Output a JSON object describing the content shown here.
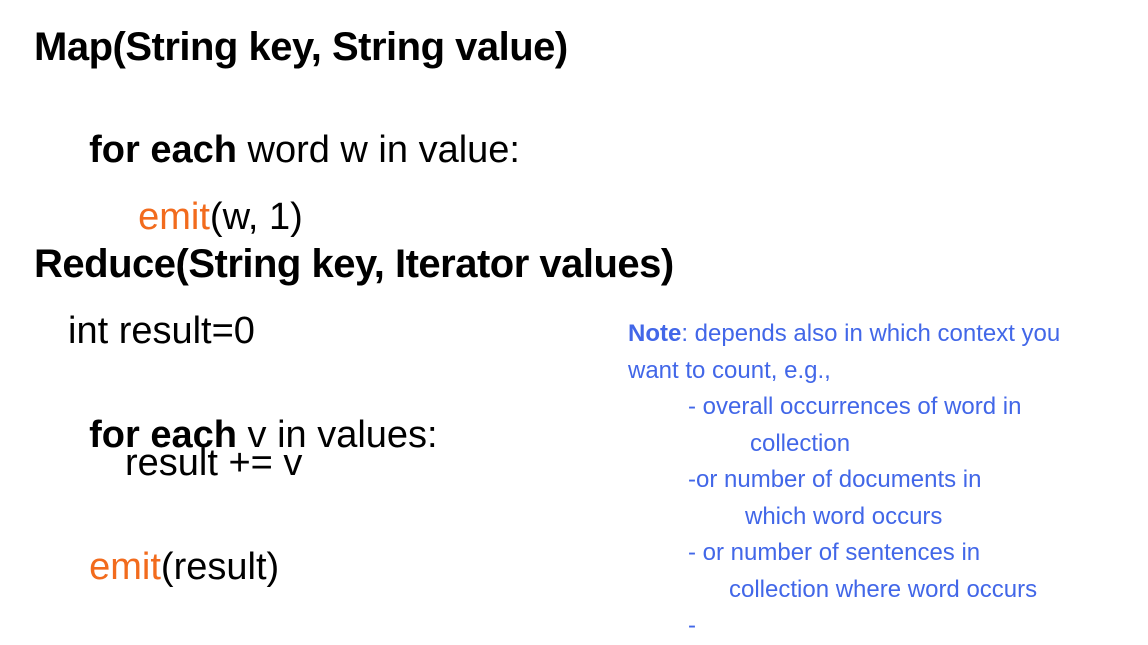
{
  "map_section": {
    "signature": "Map(String key, String value)",
    "loop_keyword": "for each",
    "loop_rest": " word w in value:",
    "emit_keyword": "emit",
    "emit_args": "(w, 1)"
  },
  "reduce_section": {
    "signature": "Reduce(String key, Iterator values)",
    "init_line": "int result=0",
    "loop_keyword": "for each",
    "loop_rest": " v in values:",
    "accumulate_line": "result += v",
    "emit_keyword": "emit",
    "emit_args": "(result)"
  },
  "note": {
    "label": "Note",
    "intro_rest": ": depends also in which context you",
    "intro_line2": "want to count, e.g.,",
    "items": [
      "- overall occurrences of word in",
      "collection",
      "-or number of documents in",
      "which word occurs",
      "- or number of sentences in",
      "collection where word occurs",
      "-"
    ]
  },
  "colors": {
    "emit": "#f26b1d",
    "note": "#4267e8",
    "text": "#000000"
  }
}
